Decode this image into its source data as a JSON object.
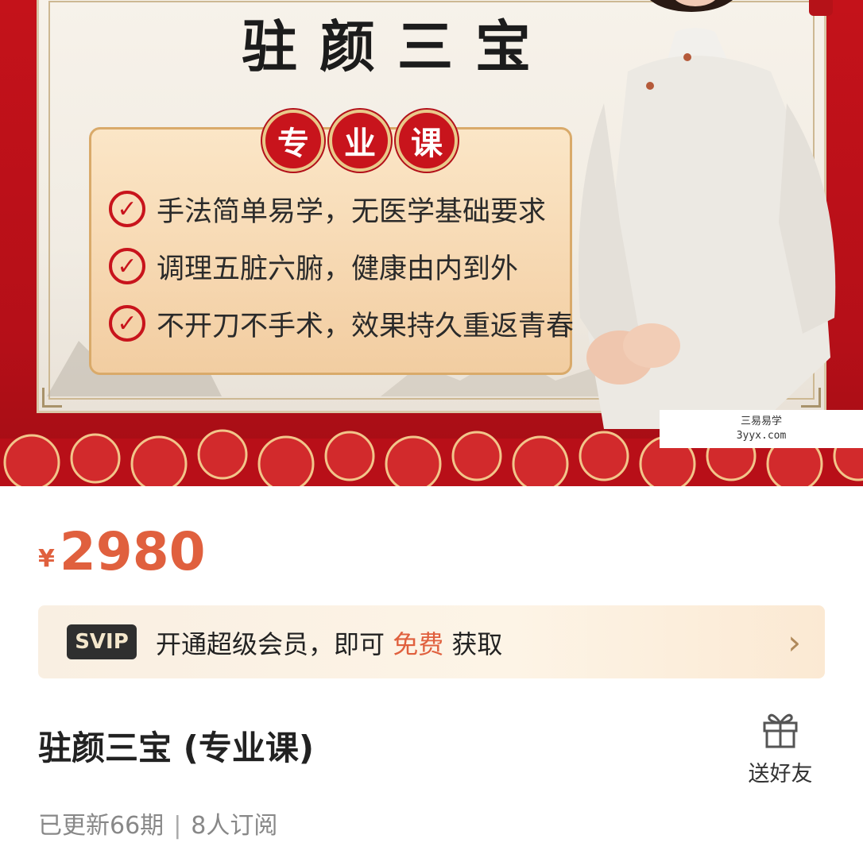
{
  "banner": {
    "title": "驻颜三宝",
    "badge_chars": [
      "专",
      "业",
      "课"
    ],
    "features": [
      "手法简单易学，无医学基础要求",
      "调理五脏六腑，健康由内到外",
      "不开刀不手术，效果持久重返青春"
    ],
    "watermark_line1": "三易易学",
    "watermark_line2": "3yyx.com"
  },
  "price": {
    "symbol": "¥",
    "value": "2980"
  },
  "vip": {
    "tag": "SVIP",
    "text_before": "开通超级会员，即可",
    "highlight": "免费",
    "text_after": "获取",
    "arrow": "›"
  },
  "course": {
    "title": "驻颜三宝 (专业课)",
    "gift_label": "送好友",
    "updated": "已更新66期",
    "subscribers": "8人订阅"
  },
  "colors": {
    "accent": "#e0603e",
    "banner_red": "#c4121a"
  },
  "icons": [
    "check-icon",
    "gift-icon",
    "chevron-right-icon"
  ]
}
